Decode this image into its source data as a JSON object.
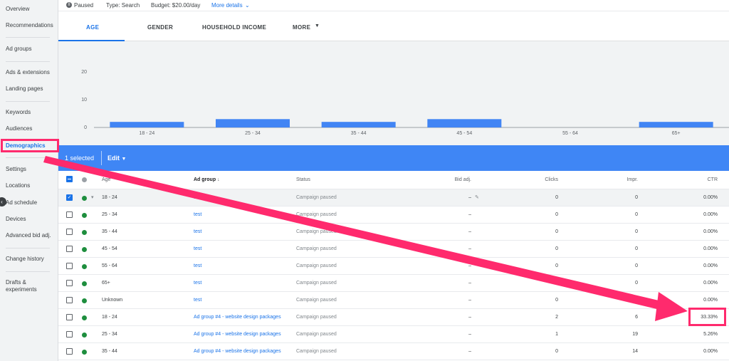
{
  "sidebar": {
    "items": [
      {
        "label": "Overview"
      },
      {
        "label": "Recommendations"
      },
      {
        "label": "Ad groups"
      },
      {
        "label": "Ads & extensions"
      },
      {
        "label": "Landing pages"
      },
      {
        "label": "Keywords"
      },
      {
        "label": "Audiences"
      },
      {
        "label": "Demographics"
      },
      {
        "label": "Settings"
      },
      {
        "label": "Locations"
      },
      {
        "label": "Ad schedule"
      },
      {
        "label": "Devices"
      },
      {
        "label": "Advanced bid adj."
      },
      {
        "label": "Change history"
      },
      {
        "label": "Drafts &"
      },
      {
        "label": "experiments"
      }
    ],
    "active": "Demographics"
  },
  "status_bar": {
    "status": "Paused",
    "type": "Type: Search",
    "budget": "Budget: $20.00/day",
    "more_details": "More details"
  },
  "tabs": [
    {
      "label": "AGE"
    },
    {
      "label": "GENDER"
    },
    {
      "label": "HOUSEHOLD INCOME"
    },
    {
      "label": "MORE"
    }
  ],
  "chart_data": {
    "type": "bar",
    "categories": [
      "18 - 24",
      "25 - 34",
      "35 - 44",
      "45 - 54",
      "55 - 64",
      "65+"
    ],
    "values": [
      2,
      3,
      2,
      3,
      0,
      2
    ],
    "ylim": [
      0,
      20
    ],
    "yticks": [
      "0",
      "10",
      "20"
    ],
    "bar_color": "#4285f4",
    "grid": false
  },
  "selection": {
    "count_label": "1 selected",
    "edit_label": "Edit"
  },
  "table": {
    "headers": {
      "age": "Age",
      "ad_group": "Ad group",
      "status": "Status",
      "bid_adj": "Bid adj.",
      "clicks": "Clicks",
      "impr": "Impr.",
      "ctr": "CTR"
    },
    "rows": [
      {
        "age": "18 - 24",
        "ad_group": "test",
        "status": "Campaign paused",
        "bid_adj": "–",
        "clicks": "0",
        "impr": "0",
        "ctr": "0.00%",
        "checked": true
      },
      {
        "age": "25 - 34",
        "ad_group": "test",
        "status": "Campaign paused",
        "bid_adj": "–",
        "clicks": "0",
        "impr": "0",
        "ctr": "0.00%",
        "checked": false
      },
      {
        "age": "35 - 44",
        "ad_group": "test",
        "status": "Campaign paused",
        "bid_adj": "–",
        "clicks": "0",
        "impr": "0",
        "ctr": "0.00%",
        "checked": false
      },
      {
        "age": "45 - 54",
        "ad_group": "test",
        "status": "Campaign paused",
        "bid_adj": "–",
        "clicks": "0",
        "impr": "0",
        "ctr": "0.00%",
        "checked": false
      },
      {
        "age": "55 - 64",
        "ad_group": "test",
        "status": "Campaign paused",
        "bid_adj": "–",
        "clicks": "0",
        "impr": "0",
        "ctr": "0.00%",
        "checked": false
      },
      {
        "age": "65+",
        "ad_group": "test",
        "status": "Campaign paused",
        "bid_adj": "–",
        "clicks": "0",
        "impr": "0",
        "ctr": "0.00%",
        "checked": false
      },
      {
        "age": "Unknown",
        "ad_group": "test",
        "status": "Campaign paused",
        "bid_adj": "–",
        "clicks": "0",
        "impr": "0",
        "ctr": "0.00%",
        "checked": false
      },
      {
        "age": "18 - 24",
        "ad_group": "Ad group #4 - website design packages",
        "status": "Campaign paused",
        "bid_adj": "–",
        "clicks": "2",
        "impr": "6",
        "ctr": "33.33%",
        "checked": false
      },
      {
        "age": "25 - 34",
        "ad_group": "Ad group #4 - website design packages",
        "status": "Campaign paused",
        "bid_adj": "–",
        "clicks": "1",
        "impr": "19",
        "ctr": "5.26%",
        "checked": false
      },
      {
        "age": "35 - 44",
        "ad_group": "Ad group #4 - website design packages",
        "status": "Campaign paused",
        "bid_adj": "–",
        "clicks": "0",
        "impr": "14",
        "ctr": "0.00%",
        "checked": false
      }
    ]
  },
  "colors": {
    "accent": "#1a73e8",
    "selection_bar": "#3f86f5",
    "annotation": "#ff2a6d",
    "status_enabled": "#1e8e3e"
  }
}
